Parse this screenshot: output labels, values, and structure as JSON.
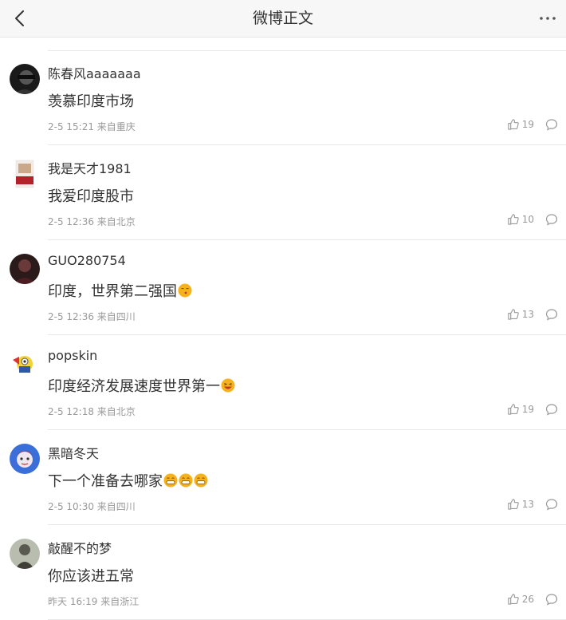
{
  "header": {
    "title": "微博正文",
    "back_icon": "chevron-left-icon",
    "more_icon": "more-horizontal-icon"
  },
  "comments": [
    {
      "user": "陈春风aaaaaaa",
      "text": "羡慕印度市场",
      "meta": "2-5 15:21 来自重庆",
      "likes": "19",
      "emojis": []
    },
    {
      "user": "我是天才1981",
      "text": "我爱印度股市",
      "meta": "2-5 12:36 来自北京",
      "likes": "10",
      "emojis": []
    },
    {
      "user": "GUO280754",
      "text": "印度，世界第二强国",
      "meta": "2-5 12:36 来自四川",
      "likes": "13",
      "emojis": [
        "kiss-face-emoji"
      ]
    },
    {
      "user": "popskin",
      "text": "印度经济发展速度世界第一",
      "meta": "2-5 12:18 来自北京",
      "likes": "19",
      "emojis": [
        "laughing-face-emoji"
      ]
    },
    {
      "user": "黑暗冬天",
      "text": "下一个准备去哪家",
      "meta": "2-5 10:30 来自四川",
      "likes": "13",
      "emojis": [
        "grin-face-emoji",
        "grin-face-emoji",
        "grin-face-emoji"
      ]
    },
    {
      "user": "敲醒不的梦",
      "text": "你应该进五常",
      "meta": "昨天 16:19 来自浙江",
      "likes": "26",
      "emojis": []
    }
  ],
  "icons": {
    "like": "thumbs-up-icon",
    "reply": "comment-bubble-icon"
  },
  "colors": {
    "header_bg": "#f7f7f7",
    "text": "#333333",
    "meta": "#999999",
    "emoji": "#f5b21a"
  }
}
